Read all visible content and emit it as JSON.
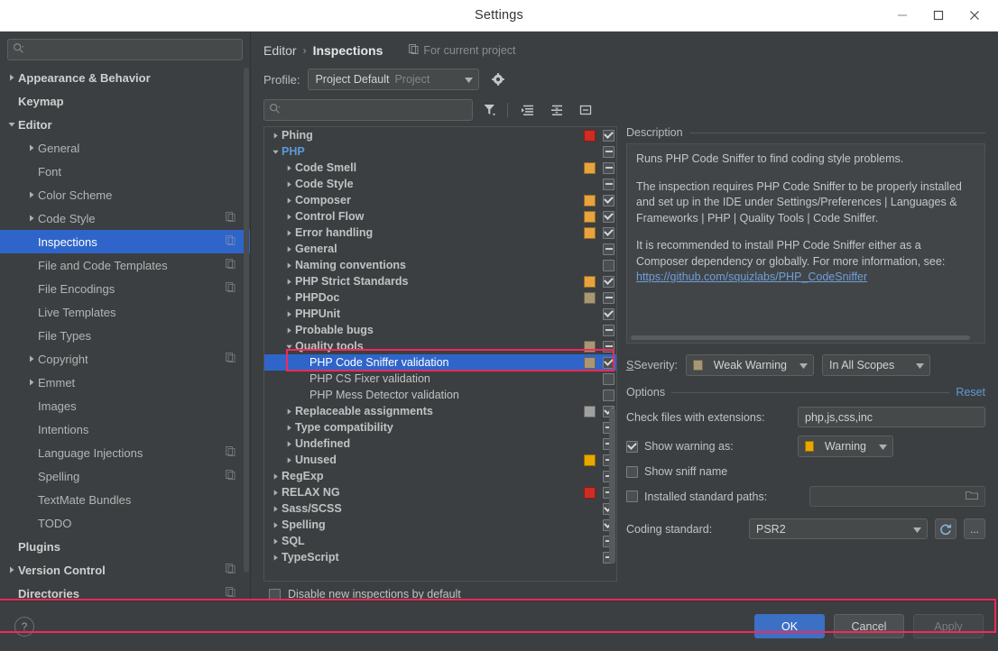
{
  "window": {
    "title": "Settings",
    "controls": {
      "minimize": "minimize-icon",
      "maximize": "maximize-icon",
      "close": "close-icon"
    }
  },
  "sidebar": {
    "search": {
      "value": "",
      "placeholder": ""
    },
    "items": [
      {
        "label": "Appearance & Behavior",
        "arrow": "right",
        "indent": 0,
        "bold": true,
        "copy": false,
        "selected": false
      },
      {
        "label": "Keymap",
        "arrow": "none",
        "indent": 0,
        "bold": true,
        "copy": false,
        "selected": false
      },
      {
        "label": "Editor",
        "arrow": "down",
        "indent": 0,
        "bold": true,
        "copy": false,
        "selected": false
      },
      {
        "label": "General",
        "arrow": "right",
        "indent": 1,
        "bold": false,
        "copy": false,
        "selected": false
      },
      {
        "label": "Font",
        "arrow": "none",
        "indent": 1,
        "bold": false,
        "copy": false,
        "selected": false
      },
      {
        "label": "Color Scheme",
        "arrow": "right",
        "indent": 1,
        "bold": false,
        "copy": false,
        "selected": false
      },
      {
        "label": "Code Style",
        "arrow": "right",
        "indent": 1,
        "bold": false,
        "copy": true,
        "selected": false
      },
      {
        "label": "Inspections",
        "arrow": "none",
        "indent": 1,
        "bold": false,
        "copy": true,
        "selected": true
      },
      {
        "label": "File and Code Templates",
        "arrow": "none",
        "indent": 1,
        "bold": false,
        "copy": true,
        "selected": false
      },
      {
        "label": "File Encodings",
        "arrow": "none",
        "indent": 1,
        "bold": false,
        "copy": true,
        "selected": false
      },
      {
        "label": "Live Templates",
        "arrow": "none",
        "indent": 1,
        "bold": false,
        "copy": false,
        "selected": false
      },
      {
        "label": "File Types",
        "arrow": "none",
        "indent": 1,
        "bold": false,
        "copy": false,
        "selected": false
      },
      {
        "label": "Copyright",
        "arrow": "right",
        "indent": 1,
        "bold": false,
        "copy": true,
        "selected": false
      },
      {
        "label": "Emmet",
        "arrow": "right",
        "indent": 1,
        "bold": false,
        "copy": false,
        "selected": false
      },
      {
        "label": "Images",
        "arrow": "none",
        "indent": 1,
        "bold": false,
        "copy": false,
        "selected": false
      },
      {
        "label": "Intentions",
        "arrow": "none",
        "indent": 1,
        "bold": false,
        "copy": false,
        "selected": false
      },
      {
        "label": "Language Injections",
        "arrow": "none",
        "indent": 1,
        "bold": false,
        "copy": true,
        "selected": false
      },
      {
        "label": "Spelling",
        "arrow": "none",
        "indent": 1,
        "bold": false,
        "copy": true,
        "selected": false
      },
      {
        "label": "TextMate Bundles",
        "arrow": "none",
        "indent": 1,
        "bold": false,
        "copy": false,
        "selected": false
      },
      {
        "label": "TODO",
        "arrow": "none",
        "indent": 1,
        "bold": false,
        "copy": false,
        "selected": false
      },
      {
        "label": "Plugins",
        "arrow": "none",
        "indent": 0,
        "bold": true,
        "copy": false,
        "selected": false
      },
      {
        "label": "Version Control",
        "arrow": "right",
        "indent": 0,
        "bold": true,
        "copy": true,
        "selected": false
      },
      {
        "label": "Directories",
        "arrow": "none",
        "indent": 0,
        "bold": true,
        "copy": true,
        "selected": false
      }
    ]
  },
  "header": {
    "breadcrumb": {
      "parent": "Editor",
      "separator": "›",
      "current": "Inspections"
    },
    "for_current_project": "For current project",
    "profile_label": "Profile:",
    "profile_value": "Project Default",
    "profile_scope": "Project",
    "gear_icon": "gear-icon"
  },
  "tree_toolbar": {
    "search": {
      "value": "",
      "placeholder": ""
    },
    "filter_icon": "filter-icon",
    "expand_all_icon": "expand-all-icon",
    "collapse_all_icon": "collapse-all-icon",
    "group_icon": "group-by-icon"
  },
  "tree": {
    "rows": [
      {
        "label": "Phing",
        "indent": 0,
        "arrow": "right",
        "bold": true,
        "sev": "#cf2c24",
        "check": "on",
        "selected": false
      },
      {
        "label": "PHP",
        "indent": 0,
        "arrow": "down",
        "bold": true,
        "sev": null,
        "check": "mixed",
        "selected": false,
        "php": true
      },
      {
        "label": "Code Smell",
        "indent": 1,
        "arrow": "right",
        "bold": true,
        "sev": "#e8a33d",
        "check": "mixed",
        "selected": false
      },
      {
        "label": "Code Style",
        "indent": 1,
        "arrow": "right",
        "bold": true,
        "sev": null,
        "check": "mixed",
        "selected": false
      },
      {
        "label": "Composer",
        "indent": 1,
        "arrow": "right",
        "bold": true,
        "sev": "#e8a33d",
        "check": "on",
        "selected": false
      },
      {
        "label": "Control Flow",
        "indent": 1,
        "arrow": "right",
        "bold": true,
        "sev": "#e8a33d",
        "check": "on",
        "selected": false
      },
      {
        "label": "Error handling",
        "indent": 1,
        "arrow": "right",
        "bold": true,
        "sev": "#e8a33d",
        "check": "on",
        "selected": false
      },
      {
        "label": "General",
        "indent": 1,
        "arrow": "right",
        "bold": true,
        "sev": null,
        "check": "mixed",
        "selected": false
      },
      {
        "label": "Naming conventions",
        "indent": 1,
        "arrow": "right",
        "bold": true,
        "sev": null,
        "check": "blank",
        "selected": false
      },
      {
        "label": "PHP Strict Standards",
        "indent": 1,
        "arrow": "right",
        "bold": true,
        "sev": "#e8a33d",
        "check": "on",
        "selected": false
      },
      {
        "label": "PHPDoc",
        "indent": 1,
        "arrow": "right",
        "bold": true,
        "sev": "#a79775",
        "check": "mixed",
        "selected": false
      },
      {
        "label": "PHPUnit",
        "indent": 1,
        "arrow": "right",
        "bold": true,
        "sev": null,
        "check": "on",
        "selected": false
      },
      {
        "label": "Probable bugs",
        "indent": 1,
        "arrow": "right",
        "bold": true,
        "sev": null,
        "check": "mixed",
        "selected": false
      },
      {
        "label": "Quality tools",
        "indent": 1,
        "arrow": "down",
        "bold": true,
        "sev": "#a79775",
        "check": "mixed",
        "selected": false
      },
      {
        "label": "PHP Code Sniffer validation",
        "indent": 2,
        "arrow": "none",
        "bold": false,
        "sev": "#a79775",
        "check": "on",
        "selected": true
      },
      {
        "label": "PHP CS Fixer validation",
        "indent": 2,
        "arrow": "none",
        "bold": false,
        "sev": null,
        "check": "blank",
        "selected": false
      },
      {
        "label": "PHP Mess Detector validation",
        "indent": 2,
        "arrow": "none",
        "bold": false,
        "sev": null,
        "check": "blank",
        "selected": false
      },
      {
        "label": "Replaceable assignments",
        "indent": 1,
        "arrow": "right",
        "bold": true,
        "sev": "#a0a0a0",
        "check": "on",
        "selected": false
      },
      {
        "label": "Type compatibility",
        "indent": 1,
        "arrow": "right",
        "bold": true,
        "sev": null,
        "check": "mixed",
        "selected": false
      },
      {
        "label": "Undefined",
        "indent": 1,
        "arrow": "right",
        "bold": true,
        "sev": null,
        "check": "mixed",
        "selected": false
      },
      {
        "label": "Unused",
        "indent": 1,
        "arrow": "right",
        "bold": true,
        "sev": "#e8a800",
        "check": "mixed",
        "selected": false
      },
      {
        "label": "RegExp",
        "indent": 0,
        "arrow": "right",
        "bold": true,
        "sev": null,
        "check": "mixed",
        "selected": false
      },
      {
        "label": "RELAX NG",
        "indent": 0,
        "arrow": "right",
        "bold": true,
        "sev": "#cf2c24",
        "check": "mixed",
        "selected": false
      },
      {
        "label": "Sass/SCSS",
        "indent": 0,
        "arrow": "right",
        "bold": true,
        "sev": null,
        "check": "on",
        "selected": false
      },
      {
        "label": "Spelling",
        "indent": 0,
        "arrow": "right",
        "bold": true,
        "sev": null,
        "check": "on",
        "selected": false
      },
      {
        "label": "SQL",
        "indent": 0,
        "arrow": "right",
        "bold": true,
        "sev": null,
        "check": "mixed",
        "selected": false
      },
      {
        "label": "TypeScript",
        "indent": 0,
        "arrow": "right",
        "bold": true,
        "sev": null,
        "check": "mixed",
        "selected": false
      }
    ],
    "disable_new_label": "Disable new inspections by default",
    "disable_new_checked": false
  },
  "description": {
    "header": "Description",
    "p1": "Runs PHP Code Sniffer to find coding style problems.",
    "p2": "The inspection requires PHP Code Sniffer to be properly installed and set up in the IDE under Settings/Preferences | Languages & Frameworks | PHP | Quality Tools | Code Sniffer.",
    "p3_prefix": "It is recommended to install PHP Code Sniffer either as a Composer dependency or globally. For more information, see: ",
    "link": "https://github.com/squizlabs/PHP_CodeSniffer"
  },
  "severity": {
    "label": "Severity:",
    "value": "Weak Warning",
    "color": "#a79775",
    "scope": "In All Scopes"
  },
  "options": {
    "header": "Options",
    "reset": "Reset",
    "extensions_label": "Check files with extensions:",
    "extensions_value": "php,js,css,inc",
    "show_warning_label": "Show warning as:",
    "show_warning_checked": true,
    "show_warning_value": "Warning",
    "show_warning_color": "#e8a800",
    "show_sniff_label": "Show sniff name",
    "show_sniff_checked": false,
    "installed_paths_label": "Installed standard paths:",
    "installed_paths_checked": false,
    "installed_paths_value": "",
    "installed_paths_browse_icon": "folder-icon",
    "coding_standard_label": "Coding standard:",
    "coding_standard_value": "PSR2",
    "refresh_icon": "refresh-icon",
    "more_label": "..."
  },
  "footer": {
    "help_label": "?",
    "ok": "OK",
    "cancel": "Cancel",
    "apply": "Apply"
  },
  "colors": {
    "accent": "#2f65ca",
    "highlight": "#f2295b",
    "link": "#5b9bd5",
    "bg": "#3c3f41"
  }
}
